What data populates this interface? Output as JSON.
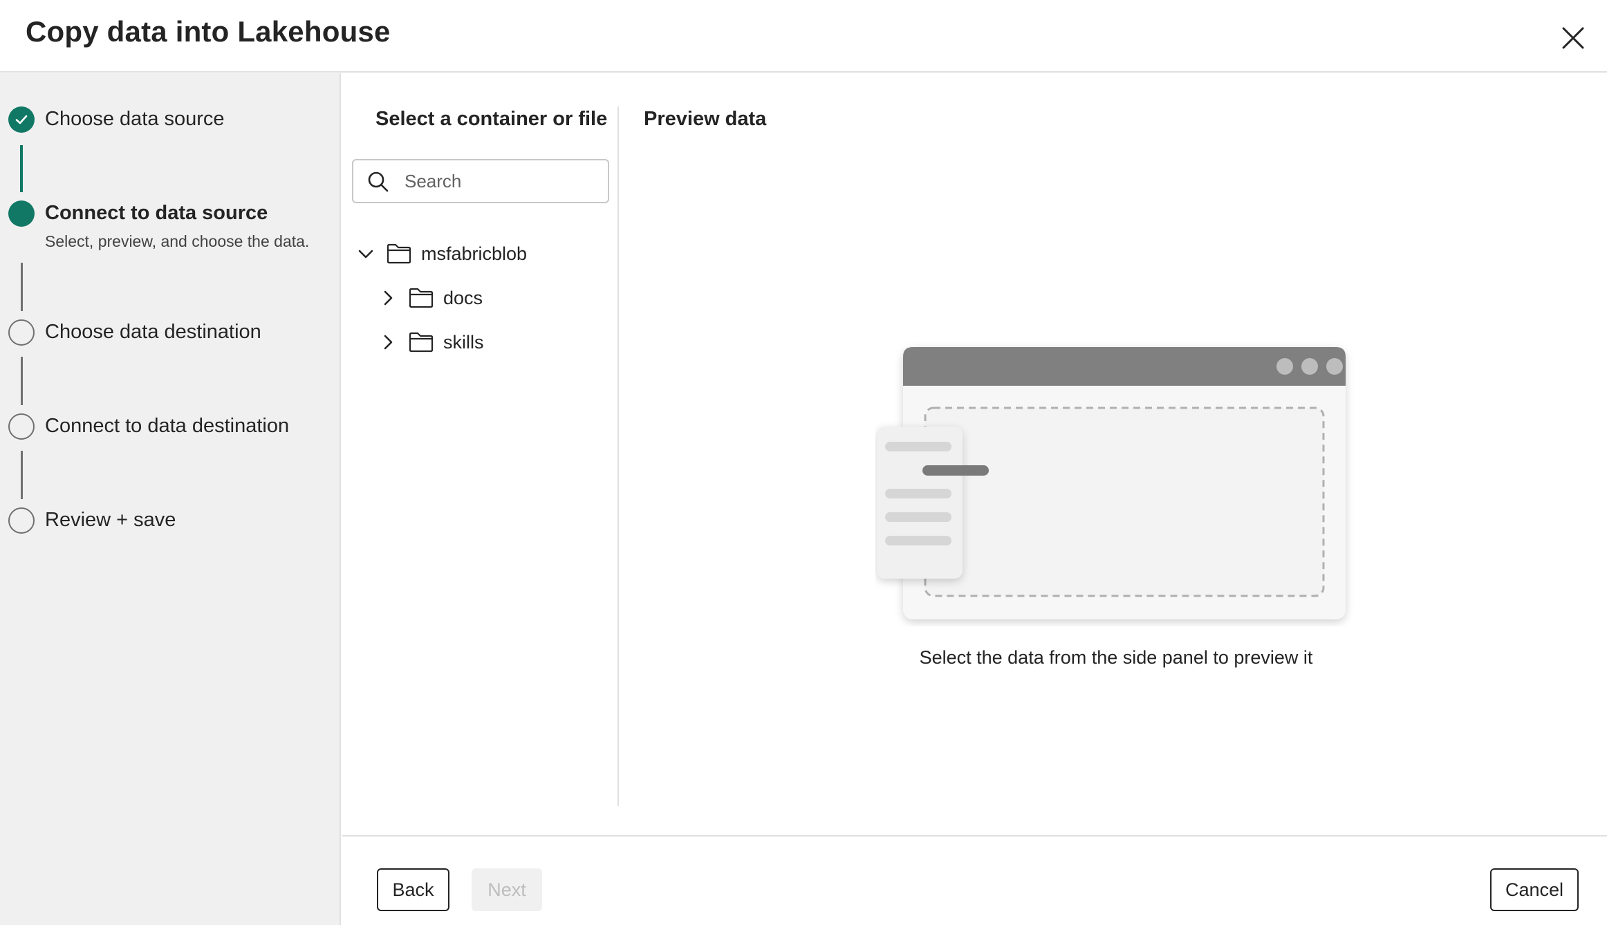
{
  "dialog": {
    "title": "Copy data into Lakehouse"
  },
  "steps": [
    {
      "label": "Choose data source",
      "status": "completed"
    },
    {
      "label": "Connect to data source",
      "status": "current",
      "description": "Select, preview, and choose the data."
    },
    {
      "label": "Choose data destination",
      "status": "pending"
    },
    {
      "label": "Connect to data destination",
      "status": "pending"
    },
    {
      "label": "Review + save",
      "status": "pending"
    }
  ],
  "tree_pane": {
    "title": "Select a container or file",
    "search": {
      "placeholder": "Search",
      "value": ""
    },
    "items": [
      {
        "label": "msfabricblob",
        "expanded": true,
        "icon": "folder-icon"
      },
      {
        "label": "docs",
        "expanded": false,
        "icon": "folder-icon"
      },
      {
        "label": "skills",
        "expanded": false,
        "icon": "folder-icon"
      }
    ]
  },
  "preview_pane": {
    "title": "Preview data",
    "caption": "Select the data from the side panel to preview it"
  },
  "footer": {
    "back_label": "Back",
    "next_label": "Next",
    "cancel_label": "Cancel"
  },
  "colors": {
    "accent": "#117865",
    "sidebar_bg": "#f0f0f0",
    "border": "#e0e0e0"
  }
}
